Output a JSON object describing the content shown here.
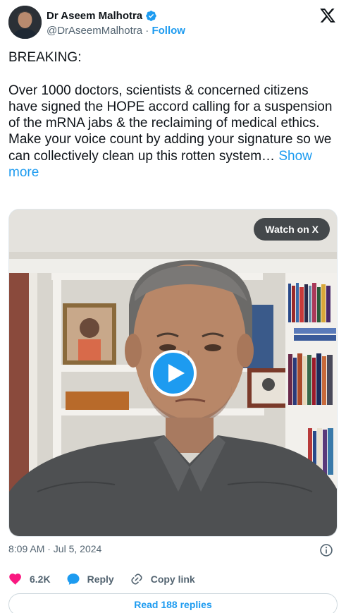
{
  "author": {
    "name": "Dr Aseem Malhotra",
    "handle": "@DrAseemMalhotra",
    "separator": "·",
    "follow_label": "Follow"
  },
  "tweet": {
    "text": "BREAKING:\n\nOver 1000 doctors, scientists & concerned citizens have signed the HOPE accord calling for a suspension of the mRNA jabs & the reclaiming of medical ethics.\nMake your voice count by adding your signature so we can collectively clean up this rotten system…",
    "show_more_label": "Show more"
  },
  "media": {
    "watch_label": "Watch on X"
  },
  "timestamp": "8:09 AM · Jul 5, 2024",
  "actions": {
    "likes": "6.2K",
    "reply_label": "Reply",
    "copy_label": "Copy link"
  },
  "read_replies_label": "Read 188 replies",
  "colors": {
    "accent": "#1d9bf0",
    "like": "#f91880",
    "text": "#0f1419",
    "muted": "#536471"
  },
  "icons": [
    "verified-badge-icon",
    "x-logo-icon",
    "play-icon",
    "info-icon",
    "heart-icon",
    "reply-bubble-icon",
    "link-icon"
  ]
}
